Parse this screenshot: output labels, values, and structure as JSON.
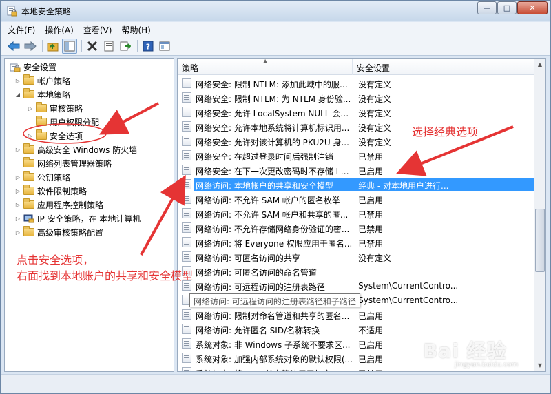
{
  "window": {
    "title": "本地安全策略",
    "minimize": "—",
    "maximize": "□",
    "close": "✕"
  },
  "menu": [
    "文件(F)",
    "操作(A)",
    "查看(V)",
    "帮助(H)"
  ],
  "toolbar_icons": [
    "back-icon",
    "forward-icon",
    "up-folder-icon",
    "show-tree-icon",
    "delete-icon",
    "properties-icon",
    "export-icon",
    "help-icon",
    "console-icon"
  ],
  "tree": [
    {
      "label": "安全设置",
      "arrow": "",
      "indent": 0
    },
    {
      "label": "帐户策略",
      "arrow": "▷",
      "indent": 1
    },
    {
      "label": "本地策略",
      "arrow": "◢",
      "indent": 1
    },
    {
      "label": "审核策略",
      "arrow": "▷",
      "indent": 2
    },
    {
      "label": "用户权限分配",
      "arrow": "",
      "indent": 2
    },
    {
      "label": "安全选项",
      "arrow": "▷",
      "indent": 2
    },
    {
      "label": "高级安全 Windows 防火墙",
      "arrow": "▷",
      "indent": 1
    },
    {
      "label": "网络列表管理器策略",
      "arrow": "",
      "indent": 1
    },
    {
      "label": "公钥策略",
      "arrow": "▷",
      "indent": 1
    },
    {
      "label": "软件限制策略",
      "arrow": "▷",
      "indent": 1
    },
    {
      "label": "应用程序控制策略",
      "arrow": "▷",
      "indent": 1
    },
    {
      "label": "IP 安全策略，在 本地计算机",
      "arrow": "▷",
      "indent": 1
    },
    {
      "label": "高级审核策略配置",
      "arrow": "▷",
      "indent": 1
    }
  ],
  "columns": {
    "policy": "策略",
    "setting": "安全设置"
  },
  "policies": [
    {
      "name": "网络安全: 限制 NTLM: 添加此域中的服务...",
      "setting": "没有定义"
    },
    {
      "name": "网络安全: 限制 NTLM: 为 NTLM 身份验...",
      "setting": "没有定义"
    },
    {
      "name": "网络安全: 允许 LocalSystem NULL 会话...",
      "setting": "没有定义"
    },
    {
      "name": "网络安全: 允许本地系统将计算机标识用...",
      "setting": "没有定义"
    },
    {
      "name": "网络安全: 允许对该计算机的 PKU2U 身...",
      "setting": "没有定义"
    },
    {
      "name": "网络安全: 在超过登录时间后强制注销",
      "setting": "已禁用"
    },
    {
      "name": "网络安全: 在下一次更改密码时不存储 LA...",
      "setting": "已启用"
    },
    {
      "name": "网络访问: 本地帐户的共享和安全模型",
      "setting": "经典 - 对本地用户进行..."
    },
    {
      "name": "网络访问: 不允许 SAM 帐户的匿名枚举",
      "setting": "已启用"
    },
    {
      "name": "网络访问: 不允许 SAM 帐户和共享的匿...",
      "setting": "已禁用"
    },
    {
      "name": "网络访问: 不允许存储网络身份验证的密...",
      "setting": "已禁用"
    },
    {
      "name": "网络访问: 将 Everyone 权限应用于匿名...",
      "setting": "已禁用"
    },
    {
      "name": "网络访问: 可匿名访问的共享",
      "setting": "没有定义"
    },
    {
      "name": "网络访问: 可匿名访问的命名管道",
      "setting": ""
    },
    {
      "name": "网络访问: 可远程访问的注册表路径",
      "setting": "System\\CurrentContro..."
    },
    {
      "name": "网络访问: 可远程访问的注册表路径和子路径",
      "setting": "System\\CurrentContro..."
    },
    {
      "name": "网络访问: 限制对命名管道和共享的匿名...",
      "setting": "已启用"
    },
    {
      "name": "网络访问: 允许匿名 SID/名称转换",
      "setting": "不适用"
    },
    {
      "name": "系统对象: 非 Windows 子系统不要求区...",
      "setting": "已启用"
    },
    {
      "name": "系统对象: 加强内部系统对象的默认权限(...",
      "setting": "已启用"
    },
    {
      "name": "系统加密: 将 FIPS 兼容算法用于加密、哈...",
      "setting": "已禁用"
    }
  ],
  "selected_index": 7,
  "tooltip": "网络访问: 可远程访问的注册表路径和子路径",
  "annotations": {
    "right": "选择经典选项",
    "left_line1": "点击安全选项，",
    "left_line2": "右面找到本地账户的共享和安全模型"
  },
  "watermark": {
    "main": "Bai 经验",
    "sub": "jingyan.baidu.com"
  },
  "colors": {
    "selection": "#3399ff",
    "annotation": "#e53434"
  }
}
